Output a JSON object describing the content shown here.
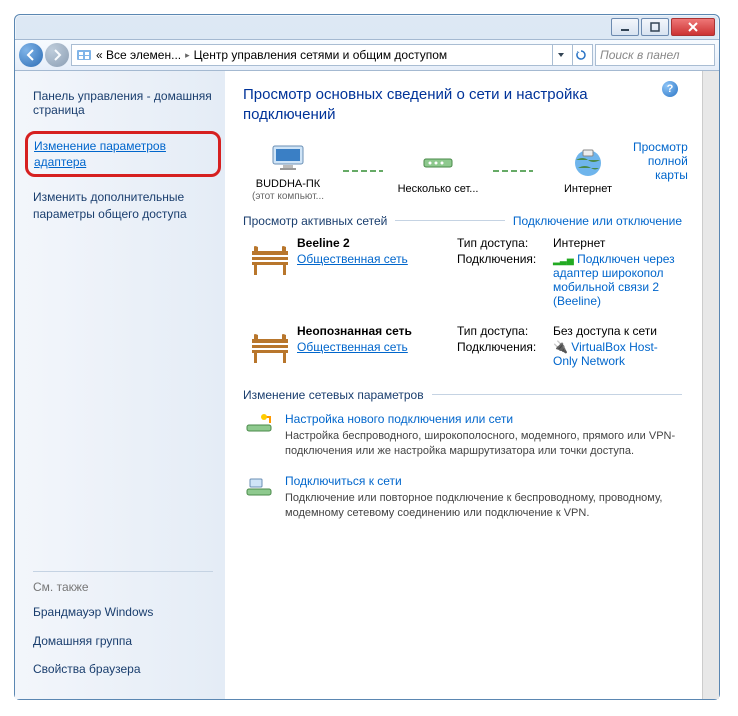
{
  "titlebar": {
    "min": "_",
    "max": "▢",
    "close": "✕"
  },
  "nav": {
    "breadcrumb_prefix": "« Все элемен...",
    "breadcrumb_current": "Центр управления сетями и общим доступом",
    "search_placeholder": "Поиск в панел"
  },
  "sidebar": {
    "home": "Панель управления - домашняя страница",
    "link1": "Изменение параметров адаптера",
    "link2": "Изменить дополнительные параметры общего доступа",
    "see_also": "См. также",
    "sa1": "Брандмауэр Windows",
    "sa2": "Домашняя группа",
    "sa3": "Свойства браузера"
  },
  "main": {
    "title": "Просмотр основных сведений о сети и настройка подключений",
    "full_map": "Просмотр полной карты",
    "map": {
      "pc": "BUDDHA-ПК",
      "pc_sub": "(этот компьют...",
      "mid": "Несколько сет...",
      "net": "Интернет"
    },
    "active_head": "Просмотр активных сетей",
    "conn_or_disc": "Подключение или отключение",
    "net1": {
      "name": "Beeline 2",
      "type": "Общественная сеть",
      "access_k": "Тип доступа:",
      "access_v": "Интернет",
      "conn_k": "Подключения:",
      "conn_v": "Подключен через адаптер широкопол мобильной связи 2 (Beeline)"
    },
    "net2": {
      "name": "Неопознанная сеть",
      "type": "Общественная сеть",
      "access_k": "Тип доступа:",
      "access_v": "Без доступа к сети",
      "conn_k": "Подключения:",
      "conn_v": "VirtualBox Host-Only Network"
    },
    "settings_head": "Изменение сетевых параметров",
    "task1": {
      "title": "Настройка нового подключения или сети",
      "desc": "Настройка беспроводного, широкополосного, модемного, прямого или VPN-подключения или же настройка маршрутизатора или точки доступа."
    },
    "task2": {
      "title": "Подключиться к сети",
      "desc": "Подключение или повторное подключение к беспроводному, проводному, модемному сетевому соединению или подключение к VPN."
    }
  }
}
